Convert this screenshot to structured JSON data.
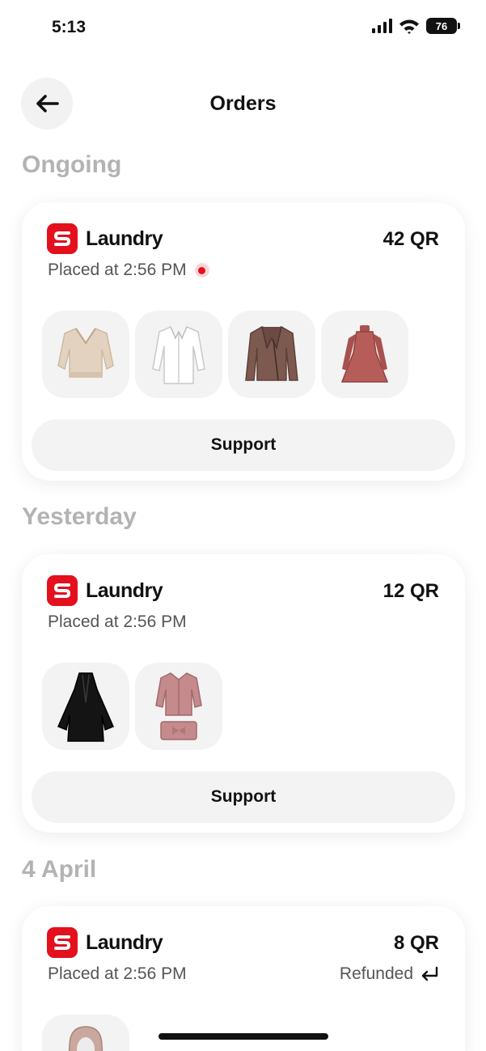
{
  "status_bar": {
    "time": "5:13",
    "battery": "76"
  },
  "header": {
    "title": "Orders"
  },
  "sections": [
    {
      "heading": "Ongoing",
      "order": {
        "brand": "Laundry",
        "price": "42 QR",
        "placed": "Placed at 2:56 PM",
        "live": true,
        "support_label": "Support",
        "items": [
          "sweater-icon",
          "white-shirt-icon",
          "leather-jacket-icon",
          "dress-icon"
        ]
      }
    },
    {
      "heading": "Yesterday",
      "order": {
        "brand": "Laundry",
        "price": "12 QR",
        "placed": "Placed at 2:56 PM",
        "support_label": "Support",
        "items": [
          "abaya-icon",
          "pajama-set-icon"
        ]
      }
    },
    {
      "heading": "4 April",
      "order": {
        "brand": "Laundry",
        "price": "8 QR",
        "placed": "Placed at 2:56 PM",
        "status": "Refunded",
        "items": [
          "hijab-icon"
        ]
      }
    }
  ],
  "colors": {
    "brand_red": "#e3101d",
    "heading_gray": "#b3b3b3",
    "thumb_bg": "#f3f3f3"
  }
}
